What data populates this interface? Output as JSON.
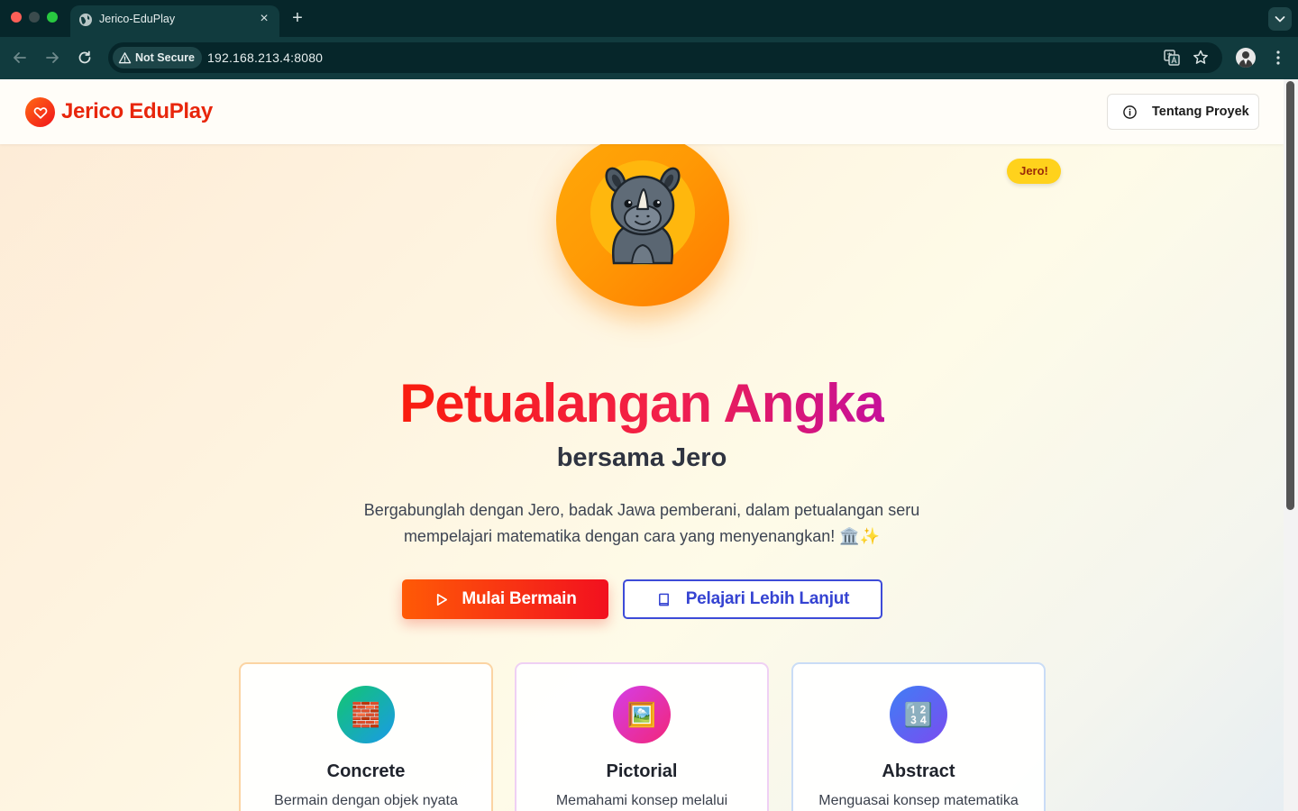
{
  "browser": {
    "tab_title": "Jerico-EduPlay",
    "tab_close": "×",
    "new_tab": "+",
    "security_label": "Not Secure",
    "url": "192.168.213.4:8080",
    "colors": {
      "frame": "#06262a",
      "toolbar": "#113b3e"
    }
  },
  "header": {
    "logo_text": "Jerico EduPlay",
    "about_button": "Tentang Proyek"
  },
  "hero": {
    "badge": "Jero!",
    "title": "Petualangan Angka",
    "subtitle": "bersama Jero",
    "description": "Bergabunglah dengan Jero, badak Jawa pemberani, dalam petualangan seru mempelajari matematika dengan cara yang menyenangkan! 🏛️✨",
    "primary_button": "Mulai Bermain",
    "secondary_button": "Pelajari Lebih Lanjut"
  },
  "cards": [
    {
      "title": "Concrete",
      "desc": "Bermain dengan objek nyata",
      "icon": "🧱",
      "icon_name": "bricks-icon"
    },
    {
      "title": "Pictorial",
      "desc": "Memahami konsep melalui",
      "icon": "🖼️",
      "icon_name": "picture-icon"
    },
    {
      "title": "Abstract",
      "desc": "Menguasai konsep matematika",
      "icon": "🔢",
      "icon_name": "numbers-icon"
    }
  ],
  "icons": {
    "logo": "heart-icon",
    "about": "info-icon",
    "play": "play-icon",
    "book": "book-icon"
  },
  "colors": {
    "brand": "#e8260c",
    "primary_button": "#f2101f",
    "secondary_button": "#3543d2",
    "badge": "#ffd21c"
  }
}
